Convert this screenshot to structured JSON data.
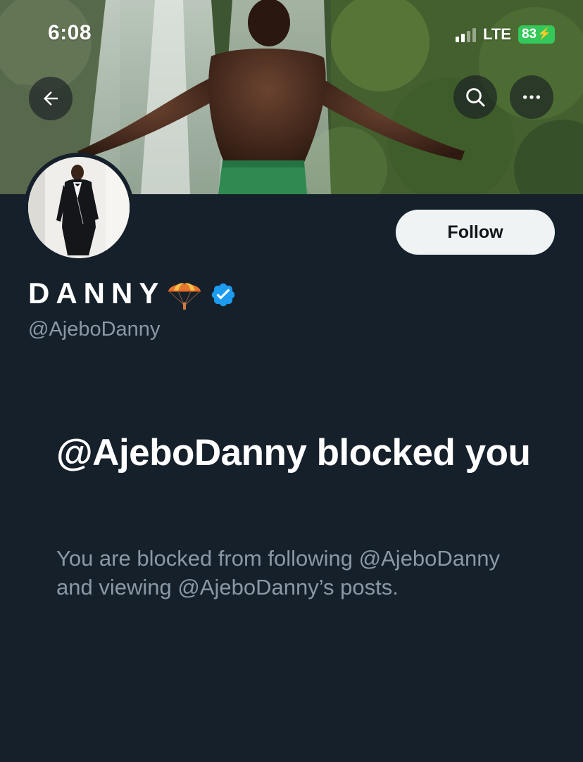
{
  "status_bar": {
    "time": "6:08",
    "network": "LTE",
    "battery": "83"
  },
  "header": {
    "back_icon": "arrow-left-icon",
    "search_icon": "search-icon",
    "more_icon": "more-horizontal-icon"
  },
  "profile": {
    "display_name": "DANNY",
    "name_emoji": "parachute-icon",
    "verified_icon": "verified-badge-icon",
    "handle": "@AjeboDanny",
    "follow_label": "Follow"
  },
  "blocked": {
    "title": "@AjeboDanny blocked you",
    "description": "You are blocked from following @AjeboDanny and viewing @AjeboDanny’s posts."
  },
  "colors": {
    "background": "#15202b",
    "secondary_text": "#8b98a5",
    "follow_button_bg": "#eff3f4",
    "verified_blue": "#1d9bf0",
    "battery_green": "#34c759"
  }
}
